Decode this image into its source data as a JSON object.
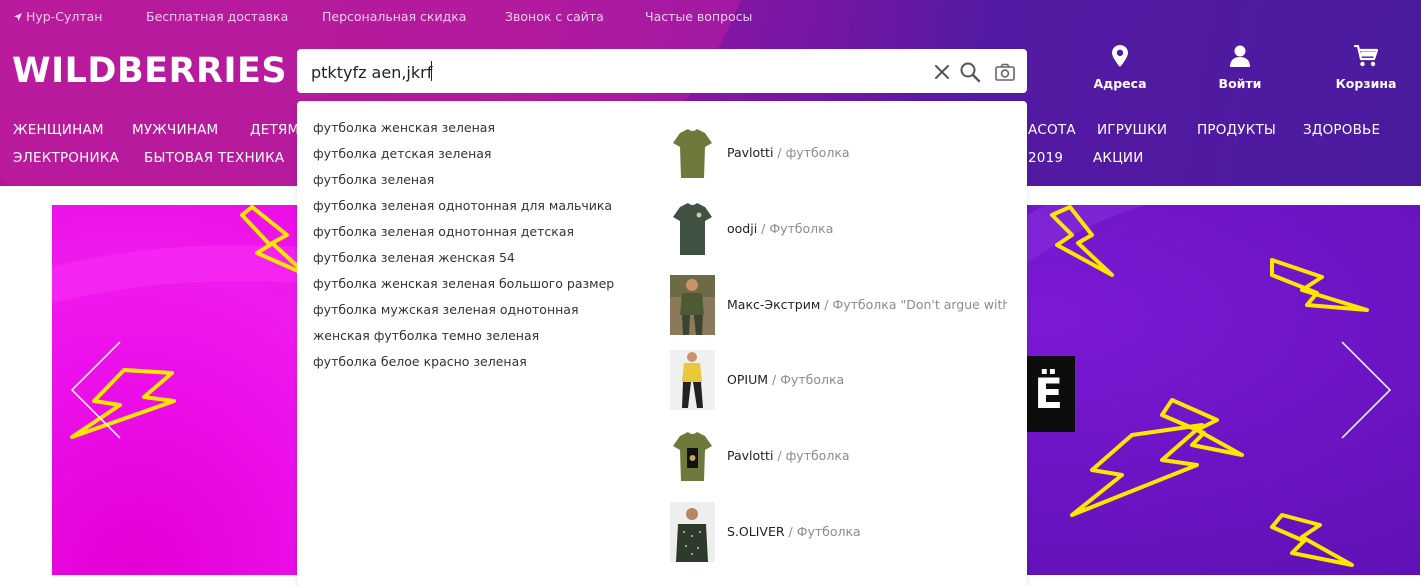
{
  "topbar": {
    "location": "Нур-Султан",
    "links": [
      "Бесплатная доставка",
      "Персональная скидка",
      "Звонок с сайта",
      "Частые вопросы"
    ]
  },
  "logo": "WILDBERRIES",
  "search": {
    "value": "ptktyfz aen,jkrf",
    "clear_icon": "close-icon",
    "search_icon": "search-icon",
    "camera_icon": "camera-icon"
  },
  "actions": {
    "addresses": "Адреса",
    "login": "Войти",
    "cart": "Корзина"
  },
  "nav": {
    "row1": [
      "ЖЕНЩИНАМ",
      "МУЖЧИНАМ",
      "ДЕТЯМ",
      "АСОТА",
      "ИГРУШКИ",
      "ПРОДУКТЫ",
      "ЗДОРОВЬЕ"
    ],
    "row2": [
      "ЭЛЕКТРОНИКА",
      "БЫТОВАЯ ТЕХНИКА",
      "2019",
      "АКЦИИ"
    ]
  },
  "suggestions": [
    "футболка женская зеленая",
    "футболка детская зеленая",
    "футболка зеленая",
    "футболка зеленая однотонная для мальчика",
    "футболка зеленая однотонная детская",
    "футболка зеленая женская 54",
    "футболка женская зеленая большого размер",
    "футболка мужская зеленая однотонная",
    "женская футболка темно зеленая",
    "футболка белое красно зеленая"
  ],
  "products": [
    {
      "brand": "Pavlotti",
      "sep": " / ",
      "type": "футболка",
      "thumb": "olive-tshirt"
    },
    {
      "brand": "oodji",
      "sep": " / ",
      "type": "Футболка",
      "thumb": "dark-green-tshirt"
    },
    {
      "brand": "Макс-Экстрим",
      "sep": " / ",
      "type": "Футболка \"Don't argue with",
      "thumb": "model-photo"
    },
    {
      "brand": "OPIUM",
      "sep": " / ",
      "type": "Футболка",
      "thumb": "yellow-model-photo"
    },
    {
      "brand": "Pavlotti",
      "sep": " / ",
      "type": "футболка",
      "thumb": "olive-print-tshirt"
    },
    {
      "brand": "S.OLIVER",
      "sep": " / ",
      "type": "Футболка",
      "thumb": "polka-model-photo"
    }
  ],
  "banner": {
    "tag_text": "Ё"
  },
  "colors": {
    "header_start": "#b0169a",
    "header_end": "#4a1b9e",
    "banner_pink": "#ec10ea",
    "banner_purple": "#6c14c4",
    "bolt": "#ffe600"
  }
}
